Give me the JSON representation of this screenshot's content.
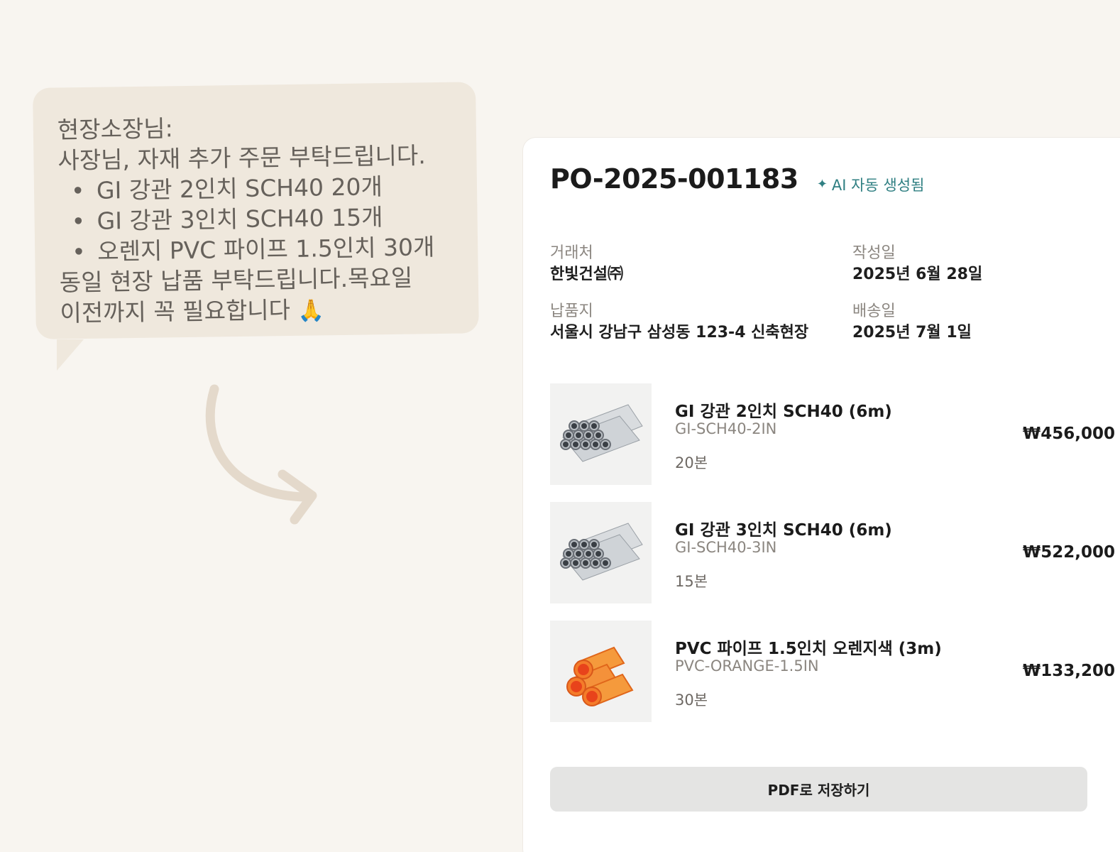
{
  "chat": {
    "sender": "현장소장님:",
    "greeting": "사장님, 자재 추가 주문 부탁드립니다.",
    "bullets": [
      "GI 강관 2인치 SCH40 20개",
      "GI 강관 3인치 SCH40 15개",
      "오렌지 PVC 파이프 1.5인치 30개"
    ],
    "closing_line1": "동일 현장 납품 부탁드립니다.목요일",
    "closing_line2": "이전까지 꼭 필요합니다",
    "emoji": "🙏"
  },
  "po": {
    "number": "PO-2025-001183",
    "ai_badge": "AI 자동 생성됨",
    "ai_icon": "sparkle-icon",
    "vendor_label": "거래처",
    "vendor_value": "한빛건설㈜",
    "created_label": "작성일",
    "created_value": "2025년 6월 28일",
    "delivery_place_label": "납품지",
    "delivery_place_value": "서울시 강남구 삼성동 123-4 신축현장",
    "delivery_date_label": "배송일",
    "delivery_date_value": "2025년 7월 1일",
    "items": [
      {
        "name": "GI 강관 2인치 SCH40 (6m)",
        "sku": "GI-SCH40-2IN",
        "qty": "20본",
        "price": "₩456,000",
        "image": "steel-pipe-bundle"
      },
      {
        "name": "GI 강관 3인치 SCH40 (6m)",
        "sku": "GI-SCH40-3IN",
        "qty": "15본",
        "price": "₩522,000",
        "image": "steel-pipe-bundle"
      },
      {
        "name": "PVC 파이프 1.5인치 오렌지색 (3m)",
        "sku": "PVC-ORANGE-1.5IN",
        "qty": "30본",
        "price": "₩133,200",
        "image": "orange-pvc-pipes"
      }
    ],
    "pdf_button": "PDF로 저장하기"
  },
  "colors": {
    "background": "#f8f5f0",
    "bubble": "#efe8dd",
    "accent_teal": "#2f7f82",
    "button": "#e4e4e3"
  }
}
